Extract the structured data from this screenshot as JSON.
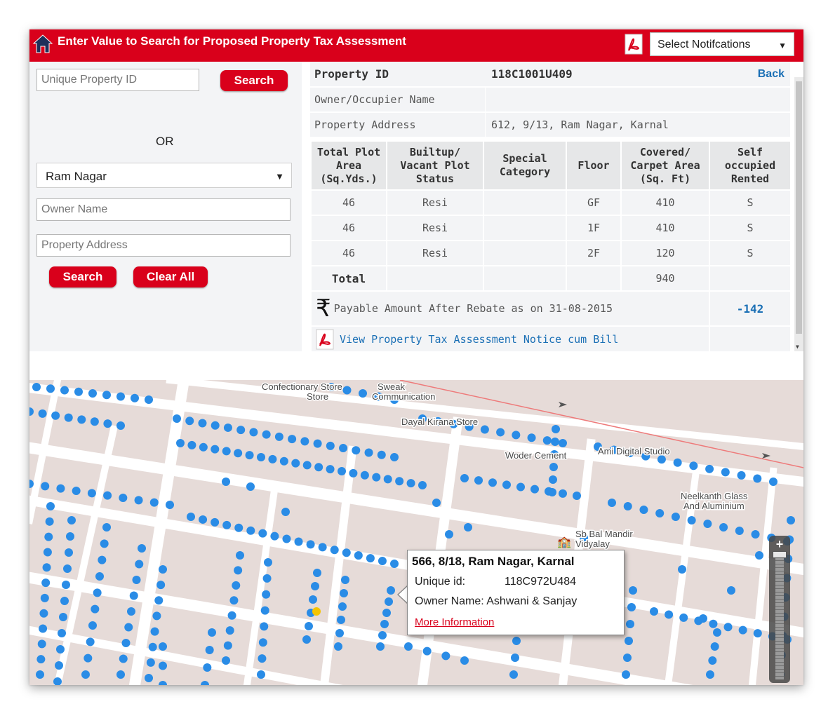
{
  "header": {
    "title": "Enter Value to Search for Proposed Property Tax Assessment",
    "notifications_select": "Select Notifcations"
  },
  "search": {
    "property_id_placeholder": "Unique Property ID",
    "search_button": "Search",
    "or_label": "OR",
    "location_selected": "Ram Nagar",
    "owner_name_placeholder": "Owner Name",
    "property_address_placeholder": "Property Address",
    "search_button_2": "Search",
    "clear_all_button": "Clear All"
  },
  "details": {
    "property_id_label": "Property ID",
    "property_id_value": "118C1001U409",
    "back_link": "Back",
    "owner_label": "Owner/Occupier Name",
    "owner_value": "",
    "address_label": "Property Address",
    "address_value": "612, 9/13, Ram Nagar, Karnal"
  },
  "table": {
    "headers": [
      [
        "Total Plot",
        "Area",
        "(Sq.Yds.)"
      ],
      [
        "Builtup/",
        "Vacant Plot",
        "Status"
      ],
      [
        "Special",
        "Category"
      ],
      [
        "Floor"
      ],
      [
        "Covered/",
        "Carpet Area",
        "(Sq. Ft)"
      ],
      [
        "Self",
        "occupied",
        "Rented"
      ]
    ],
    "rows": [
      [
        "46",
        "Resi",
        "",
        "GF",
        "410",
        "S"
      ],
      [
        "46",
        "Resi",
        "",
        "1F",
        "410",
        "S"
      ],
      [
        "46",
        "Resi",
        "",
        "2F",
        "120",
        "S"
      ]
    ],
    "total_label": "Total",
    "total_value": "940",
    "payable_label": "Payable Amount After Rebate as on 31-08-2015",
    "payable_value": "-142",
    "view_notice_link": "View Property Tax Assessment Notice cum Bill"
  },
  "map": {
    "labels": [
      "Confectionary Store",
      "Sweak",
      "Communication",
      "Dayal Kirana Store",
      "Woder Cement",
      "Ami Digital Studio",
      "Neelkanth Glass And Aluminium",
      "Sb Bal Mandir Vidyalay"
    ],
    "popup": {
      "title": "566, 8/18, Ram Nagar, Karnal",
      "unique_id_label": "Unique id:",
      "unique_id_value": "118C972U484",
      "owner_label": "Owner Name: Ashwani & Sanjay",
      "more_link": "More Information"
    },
    "zoom_in": "+"
  },
  "colors": {
    "brand_red": "#d9001b",
    "link_blue": "#1a6fb5",
    "marker_blue": "#2a8ce6",
    "marker_selected": "#f4c400"
  }
}
